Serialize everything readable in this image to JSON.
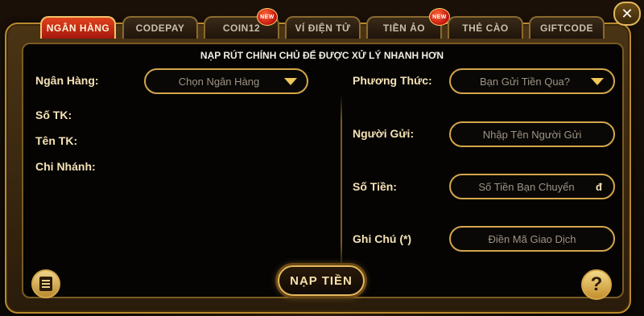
{
  "tabs": [
    {
      "label": "NGÂN HÀNG",
      "active": true,
      "new": false
    },
    {
      "label": "CODEPAY",
      "active": false,
      "new": false
    },
    {
      "label": "COIN12",
      "active": false,
      "new": true
    },
    {
      "label": "VÍ ĐIỆN TỬ",
      "active": false,
      "new": false
    },
    {
      "label": "TIỀN ẢO",
      "active": false,
      "new": true
    },
    {
      "label": "THẺ CÀO",
      "active": false,
      "new": false
    },
    {
      "label": "GIFTCODE",
      "active": false,
      "new": false
    }
  ],
  "badge_text": "NEW",
  "notice": "NẠP RÚT CHÍNH CHỦ ĐỂ ĐƯỢC XỬ LÝ NHANH HƠN",
  "left": {
    "bank_label": "Ngân Hàng:",
    "bank_select": "Chọn Ngân Hàng",
    "account_no_label": "Số TK:",
    "account_name_label": "Tên TK:",
    "branch_label": "Chi Nhánh:"
  },
  "right": {
    "method_label": "Phương Thức:",
    "method_select": "Bạn Gửi Tiền Qua?",
    "sender_label": "Người Gửi:",
    "sender_placeholder": "Nhập Tên Người Gửi",
    "amount_label": "Số Tiền:",
    "amount_placeholder": "Số Tiền Bạn Chuyển",
    "currency_symbol": "đ",
    "note_label": "Ghi Chú (*)",
    "note_placeholder": "Điền Mã Giao Dịch"
  },
  "deposit_button": "NẠP TIỀN",
  "help_symbol": "?",
  "close_symbol": "✕",
  "icons": {
    "history": "list-icon",
    "help": "question-icon",
    "close": "close-icon",
    "dropdown": "caret-down-icon"
  },
  "colors": {
    "accent_gold": "#e3b85c",
    "active_tab": "#d2321a",
    "label_text": "#f5e2b5"
  }
}
